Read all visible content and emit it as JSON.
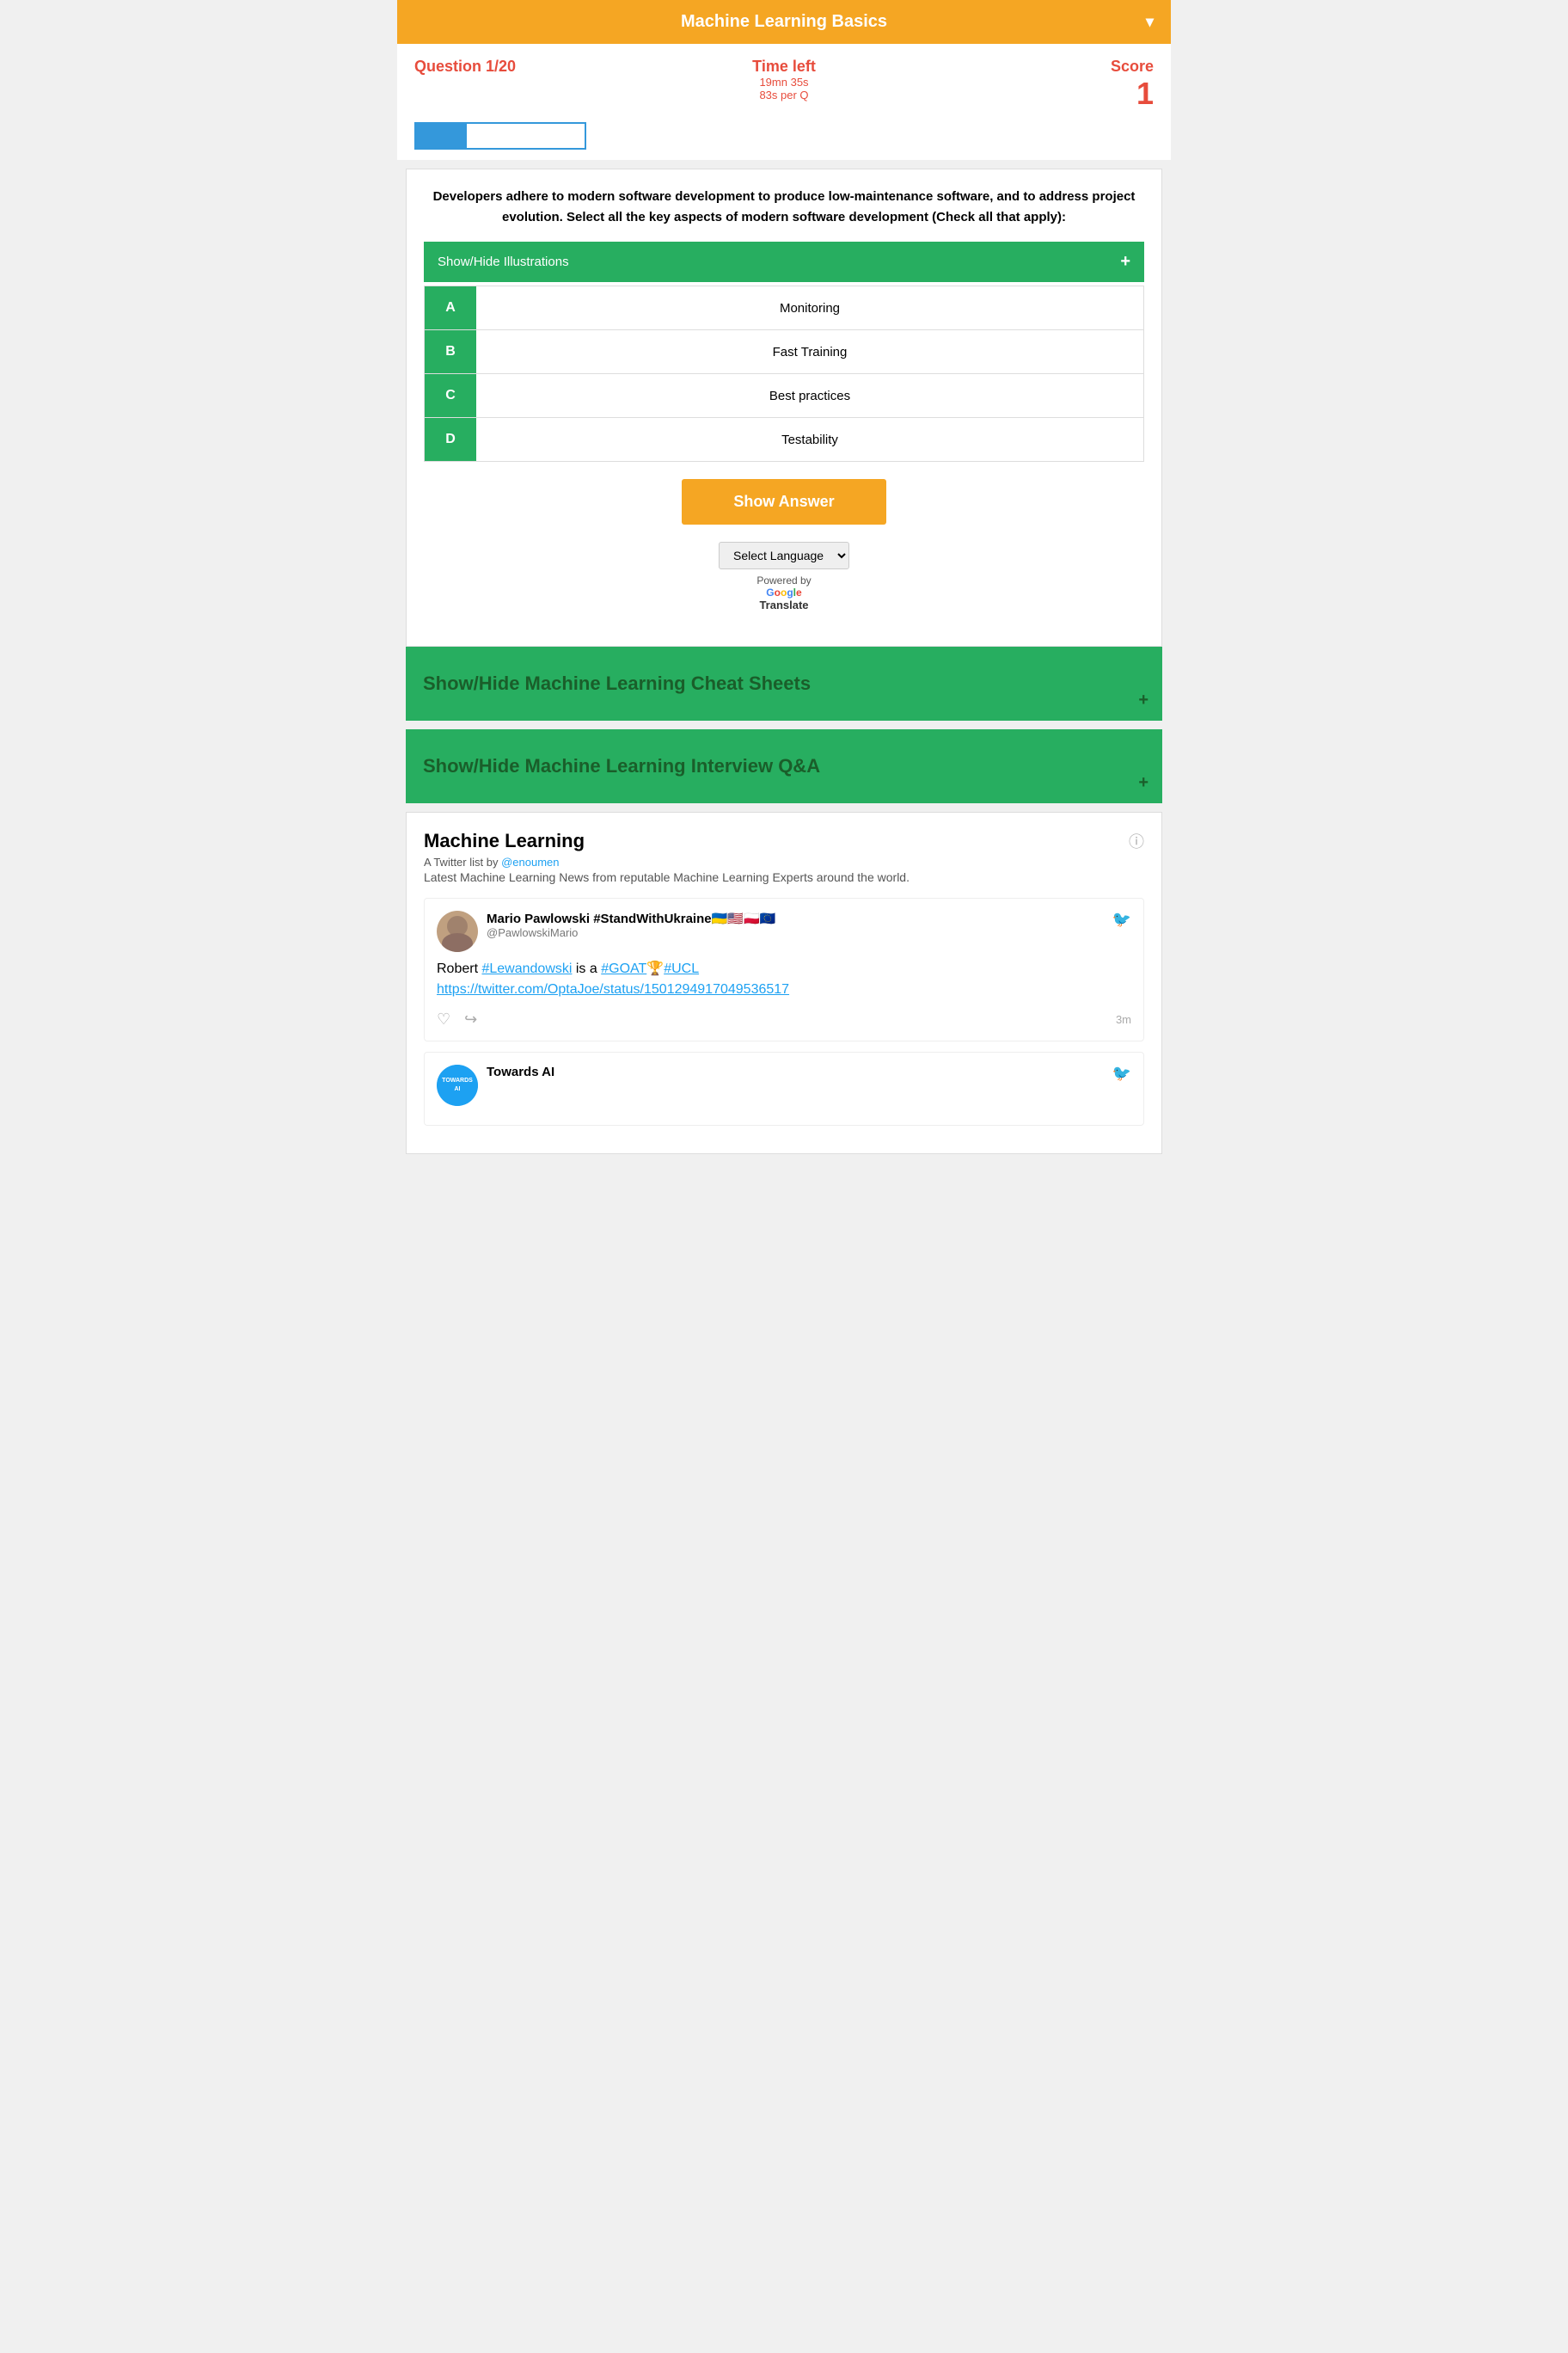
{
  "header": {
    "title": "Machine Learning Basics",
    "dropdown_icon": "▾"
  },
  "quiz_meta": {
    "question_label": "Question 1/20",
    "time_left_label": "Time left",
    "time_detail_1": "19mn 35s",
    "time_detail_2": "83s per Q",
    "score_label": "Score",
    "score_value": "1"
  },
  "question": {
    "text": "Developers adhere to modern software development to produce low-maintenance software, and to address project evolution. Select all the key aspects of modern software development (Check all that apply):",
    "illustrations_label": "Show/Hide Illustrations",
    "options": [
      {
        "letter": "A",
        "text": "Monitoring"
      },
      {
        "letter": "B",
        "text": "Fast Training"
      },
      {
        "letter": "C",
        "text": "Best practices"
      },
      {
        "letter": "D",
        "text": "Testability"
      }
    ]
  },
  "show_answer_btn": "Show Answer",
  "translate": {
    "select_label": "Select Language",
    "powered_by": "Powered by",
    "google_text": "Google",
    "translate_word": "Translate"
  },
  "cheat_sheets": {
    "label": "Show/Hide Machine Learning Cheat Sheets",
    "plus": "+"
  },
  "interview_qa": {
    "label": "Show/Hide Machine Learning Interview Q&A",
    "plus": "+"
  },
  "twitter": {
    "title": "Machine Learning",
    "meta": "A Twitter list by",
    "username": "@enoumen",
    "description": "Latest Machine Learning News from reputable Machine Learning Experts around the world.",
    "tweets": [
      {
        "display_name": "Mario Pawlowski #StandWithUkraine🇺🇦🇺🇸🇵🇱🇪🇺",
        "username": "@PawlowskiMario",
        "body_text": "Robert #Lewandowski is a #GOAT🏆#UCL https://twitter.com/OptaJoe/status/1501294917049536517",
        "timestamp": "3m",
        "avatar_type": "mario"
      },
      {
        "display_name": "Towards AI",
        "username": "",
        "avatar_type": "towards",
        "avatar_text": "TOWARDS"
      }
    ]
  }
}
